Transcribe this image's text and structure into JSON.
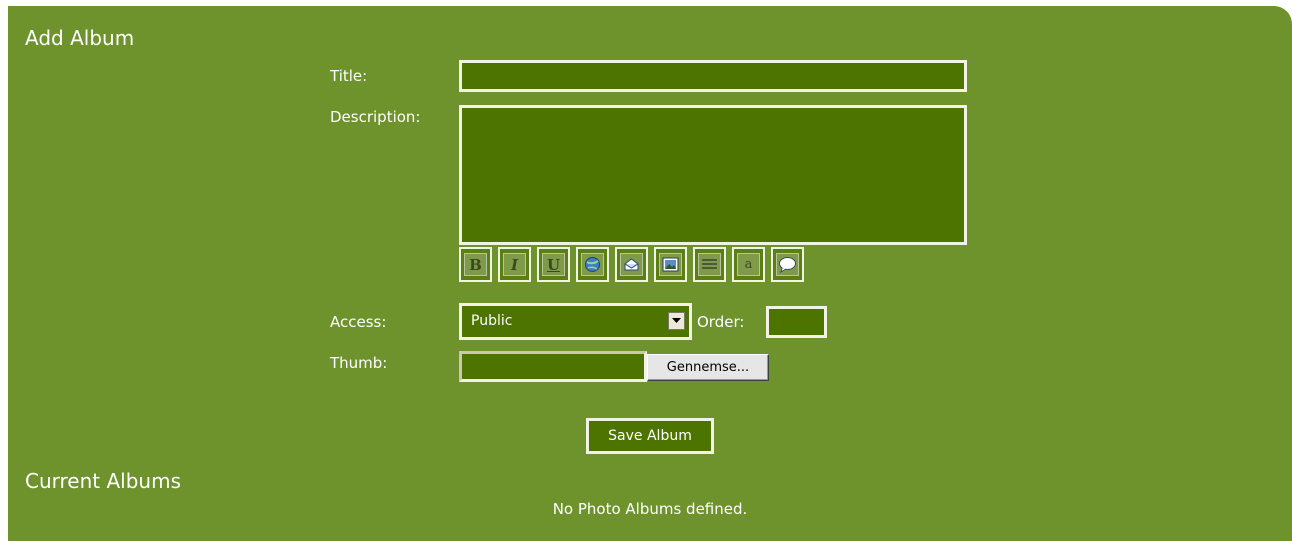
{
  "add_album": {
    "heading": "Add Album",
    "title_label": "Title:",
    "title_value": "",
    "description_label": "Description:",
    "description_value": "",
    "toolbar": [
      {
        "name": "bold-icon",
        "glyph": "B"
      },
      {
        "name": "italic-icon",
        "glyph": "I"
      },
      {
        "name": "underline-icon",
        "glyph": "U"
      },
      {
        "name": "link-globe-icon",
        "glyph": ""
      },
      {
        "name": "email-icon",
        "glyph": ""
      },
      {
        "name": "image-icon",
        "glyph": ""
      },
      {
        "name": "align-lines-icon",
        "glyph": ""
      },
      {
        "name": "code-icon",
        "glyph": "a"
      },
      {
        "name": "quote-bubble-icon",
        "glyph": ""
      }
    ],
    "access_label": "Access:",
    "access_selected": "Public",
    "order_label": "Order:",
    "order_value": "",
    "thumb_label": "Thumb:",
    "thumb_value": "",
    "browse_label": "Gennemse...",
    "save_label": "Save Album"
  },
  "current_albums": {
    "heading": "Current Albums",
    "empty_message": "No Photo Albums defined."
  },
  "colors": {
    "panel": "#6e922c",
    "field": "#4e7400",
    "border": "#f2f2e6"
  }
}
